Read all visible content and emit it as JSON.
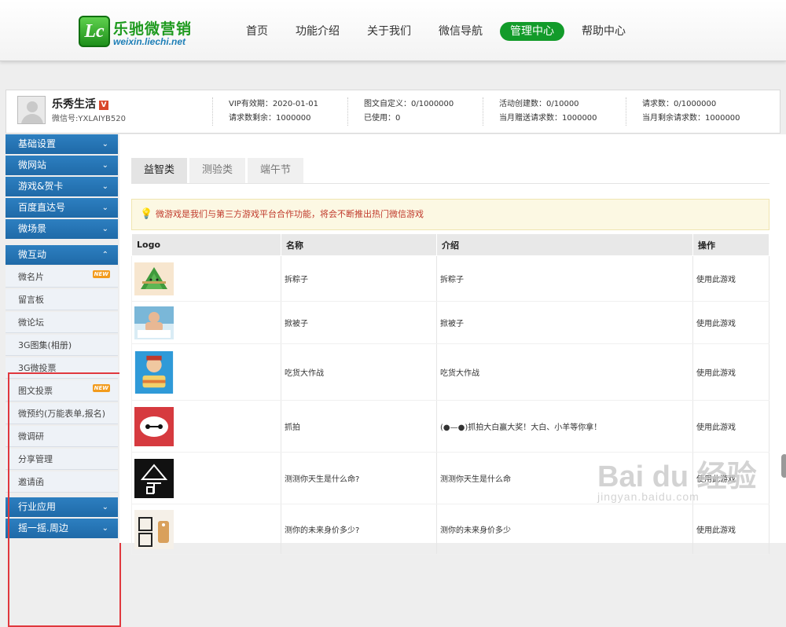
{
  "logo": {
    "mark": "Lc",
    "name": "乐驰微营销",
    "url": "weixin.liechi.net"
  },
  "nav": [
    {
      "label": "首页",
      "active": false
    },
    {
      "label": "功能介绍",
      "active": false
    },
    {
      "label": "关于我们",
      "active": false
    },
    {
      "label": "微信导航",
      "active": false
    },
    {
      "label": "管理中心",
      "active": true
    },
    {
      "label": "帮助中心",
      "active": false
    }
  ],
  "profile": {
    "name": "乐秀生活",
    "badge": "V",
    "wechat_id": "微信号:YXLAIYB520",
    "stats": [
      [
        "VIP有效期：2020-01-01",
        "请求数剩余：1000000"
      ],
      [
        "图文自定义：0/1000000",
        "已使用：0"
      ],
      [
        "活动创建数：0/10000",
        "当月赠送请求数：1000000"
      ],
      [
        "请求数：0/1000000",
        "当月剩余请求数：1000000"
      ]
    ]
  },
  "sidebar": {
    "chevron_down": "⌄",
    "chevron_up": "⌃",
    "new_tag": "NEW",
    "groups_top": [
      "基础设置",
      "微网站",
      "游戏&贺卡",
      "百度直达号",
      "微场景"
    ],
    "expanded": {
      "label": "微互动",
      "items": [
        {
          "label": "微名片",
          "new": true
        },
        {
          "label": "留言板",
          "new": false
        },
        {
          "label": "微论坛",
          "new": false
        },
        {
          "label": "3G图集(相册)",
          "new": false
        },
        {
          "label": "3G微投票",
          "new": false
        },
        {
          "label": "图文投票",
          "new": true
        },
        {
          "label": "微预约(万能表单,报名)",
          "new": false
        },
        {
          "label": "微调研",
          "new": false
        },
        {
          "label": "分享管理",
          "new": false
        },
        {
          "label": "邀请函",
          "new": false
        }
      ]
    },
    "groups_bottom": [
      "行业应用",
      "摇一摇.周边"
    ]
  },
  "tabs": [
    {
      "label": "益智类",
      "active": true
    },
    {
      "label": "测验类",
      "active": false
    },
    {
      "label": "端午节",
      "active": false
    }
  ],
  "notice": "微游戏是我们与第三方游戏平台合作功能，将会不断推出热门微信游戏",
  "table": {
    "headers": [
      "Logo",
      "名称",
      "介绍",
      "操作"
    ],
    "rows": [
      {
        "icon": "zongzi-icon",
        "name": "拆粽子",
        "intro": "拆粽子",
        "action": "使用此游戏"
      },
      {
        "icon": "quilt-icon",
        "name": "掀被子",
        "intro": "掀被子",
        "action": "使用此游戏"
      },
      {
        "icon": "foodie-icon",
        "name": "吃货大作战",
        "intro": "吃货大作战",
        "action": "使用此游戏"
      },
      {
        "icon": "baymax-icon",
        "name": "抓拍",
        "intro": "(●—●)抓拍大白赢大奖！大白、小羊等你拿！",
        "action": "使用此游戏"
      },
      {
        "icon": "fate-icon",
        "name": "测测你天生是什么命?",
        "intro": "测测你天生是什么命",
        "action": "使用此游戏"
      },
      {
        "icon": "worth-icon",
        "name": "测你的未来身价多少?",
        "intro": "测你的未来身价多少",
        "action": "使用此游戏"
      }
    ]
  },
  "watermark": {
    "main": "Bai du 经验",
    "sub": "jingyan.baidu.com"
  }
}
